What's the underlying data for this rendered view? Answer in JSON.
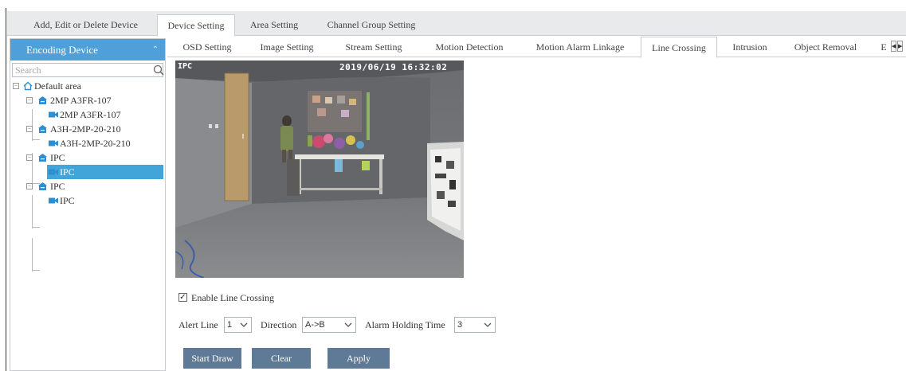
{
  "top_tabs": [
    "Add, Edit or Delete Device",
    "Device Setting",
    "Area Setting",
    "Channel Group Setting"
  ],
  "top_tabs_active": "Device Setting",
  "sidebar": {
    "header": "Encoding Device",
    "search_placeholder": "Search",
    "tree": [
      {
        "label": "Default area",
        "type": "area"
      },
      {
        "label": "2MP A3FR-107",
        "type": "device"
      },
      {
        "label": "2MP A3FR-107",
        "type": "channel"
      },
      {
        "label": "A3H-2MP-20-210",
        "type": "device"
      },
      {
        "label": "A3H-2MP-20-210",
        "type": "channel"
      },
      {
        "label": "IPC",
        "type": "device"
      },
      {
        "label": "IPC",
        "type": "channel",
        "selected": true
      },
      {
        "label": "IPC",
        "type": "device"
      },
      {
        "label": "IPC",
        "type": "channel"
      }
    ]
  },
  "sub_tabs": [
    "OSD Setting",
    "Image Setting",
    "Stream Setting",
    "Motion Detection",
    "Motion Alarm Linkage",
    "Line Crossing",
    "Intrusion",
    "Object Removal",
    "E"
  ],
  "sub_tabs_active": "Line Crossing",
  "video": {
    "osd_name": "IPC",
    "osd_time": "2019/06/19 16:32:02"
  },
  "form": {
    "enable_label": "Enable Line Crossing",
    "enable_checked": true,
    "alert_line_label": "Alert Line",
    "alert_line_value": "1",
    "direction_label": "Direction",
    "direction_value": "A->B",
    "alarm_holding_label": "Alarm Holding Time",
    "alarm_holding_value": "3"
  },
  "buttons": {
    "start_draw": "Start Draw",
    "clear": "Clear",
    "apply": "Apply"
  },
  "colors": {
    "accent": "#4fa0d8",
    "selected": "#42a5da",
    "button": "#5e7a96"
  }
}
